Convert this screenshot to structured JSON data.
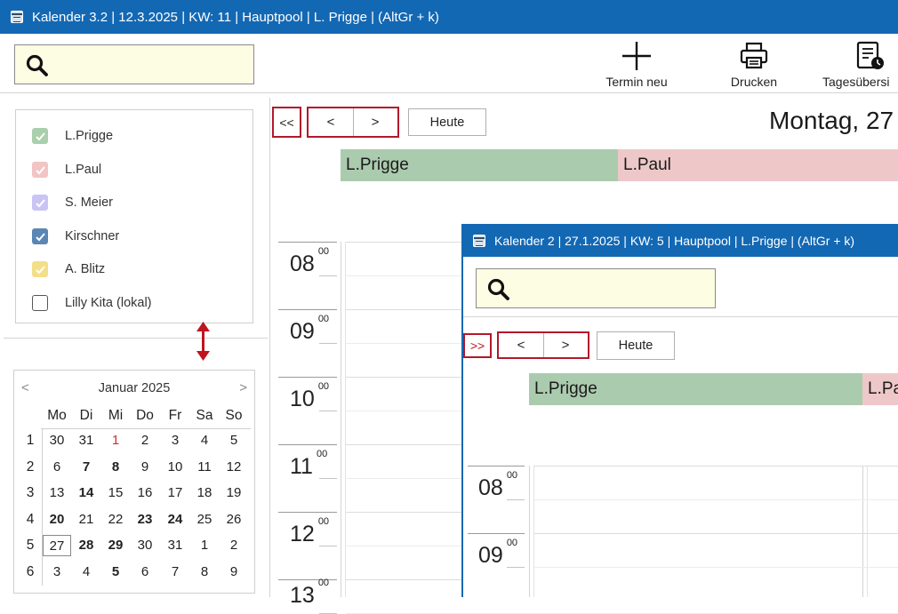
{
  "window": {
    "title": "Kalender 3.2 | 12.3.2025 | KW: 11 | Hauptpool | L. Prigge | (AltGr + k)"
  },
  "search": {
    "value": ""
  },
  "toolbar": {
    "new_label": "Termin neu",
    "print_label": "Drucken",
    "overview_label": "Tagesübersi"
  },
  "calendars": [
    {
      "label": "L.Prigge",
      "checked": true,
      "color": "#a9cfad"
    },
    {
      "label": "L.Paul",
      "checked": true,
      "color": "#f2c4c4"
    },
    {
      "label": "S. Meier",
      "checked": true,
      "color": "#c8c4f4"
    },
    {
      "label": "Kirschner",
      "checked": true,
      "color": "#5a86b5"
    },
    {
      "label": "A. Blitz",
      "checked": true,
      "color": "#f3df88"
    },
    {
      "label": "Lilly Kita (lokal)",
      "checked": false,
      "color": "#ffffff"
    }
  ],
  "minical": {
    "month_label": "Januar 2025",
    "prev": "<",
    "next": ">",
    "weekdays": [
      "Mo",
      "Di",
      "Mi",
      "Do",
      "Fr",
      "Sa",
      "So"
    ],
    "weeks": [
      {
        "num": "1",
        "days": [
          {
            "d": "30"
          },
          {
            "d": "31"
          },
          {
            "d": "1",
            "red": true
          },
          {
            "d": "2"
          },
          {
            "d": "3"
          },
          {
            "d": "4"
          },
          {
            "d": "5"
          }
        ]
      },
      {
        "num": "2",
        "days": [
          {
            "d": "6"
          },
          {
            "d": "7",
            "bold": true
          },
          {
            "d": "8",
            "bold": true
          },
          {
            "d": "9"
          },
          {
            "d": "10"
          },
          {
            "d": "11"
          },
          {
            "d": "12"
          }
        ]
      },
      {
        "num": "3",
        "days": [
          {
            "d": "13"
          },
          {
            "d": "14",
            "bold": true
          },
          {
            "d": "15"
          },
          {
            "d": "16"
          },
          {
            "d": "17"
          },
          {
            "d": "18"
          },
          {
            "d": "19"
          }
        ]
      },
      {
        "num": "4",
        "days": [
          {
            "d": "20",
            "bold": true
          },
          {
            "d": "21"
          },
          {
            "d": "22"
          },
          {
            "d": "23",
            "bold": true
          },
          {
            "d": "24",
            "bold": true
          },
          {
            "d": "25"
          },
          {
            "d": "26"
          }
        ]
      },
      {
        "num": "5",
        "days": [
          {
            "d": "27",
            "today": true
          },
          {
            "d": "28",
            "bold": true
          },
          {
            "d": "29",
            "bold": true
          },
          {
            "d": "30"
          },
          {
            "d": "31"
          },
          {
            "d": "1"
          },
          {
            "d": "2"
          }
        ]
      },
      {
        "num": "6",
        "days": [
          {
            "d": "3"
          },
          {
            "d": "4"
          },
          {
            "d": "5",
            "bold": true
          },
          {
            "d": "6"
          },
          {
            "d": "7"
          },
          {
            "d": "8"
          },
          {
            "d": "9"
          }
        ]
      }
    ]
  },
  "nav": {
    "jump_back": "<<",
    "prev": "<",
    "next": ">",
    "today": "Heute",
    "date_heading": "Montag, 27"
  },
  "resources": [
    {
      "label": "L.Prigge",
      "color": "#abcbae"
    },
    {
      "label": "L.Paul",
      "color": "#eec8c8"
    }
  ],
  "hours": [
    {
      "h": "08",
      "m": "00"
    },
    {
      "h": "09",
      "m": "00"
    },
    {
      "h": "10",
      "m": "00"
    },
    {
      "h": "11",
      "m": "00"
    },
    {
      "h": "12",
      "m": "00"
    },
    {
      "h": "13",
      "m": "00"
    }
  ],
  "window2": {
    "title": "Kalender 2 | 27.1.2025 | KW: 5 | Hauptpool | L.Prigge | (AltGr + k)",
    "search_value": "",
    "nav": {
      "jump_forward": ">>",
      "prev": "<",
      "next": ">",
      "today": "Heute"
    },
    "resources": [
      {
        "label": "L.Prigge",
        "color": "#abcbae"
      },
      {
        "label": "L.Pa",
        "color": "#eec8c8"
      }
    ],
    "hours": [
      {
        "h": "08",
        "m": "00"
      },
      {
        "h": "09",
        "m": "00"
      }
    ]
  },
  "colors": {
    "titlebar": "#1368b4",
    "accent_red": "#b3182b",
    "search_bg": "#fdfde3"
  }
}
